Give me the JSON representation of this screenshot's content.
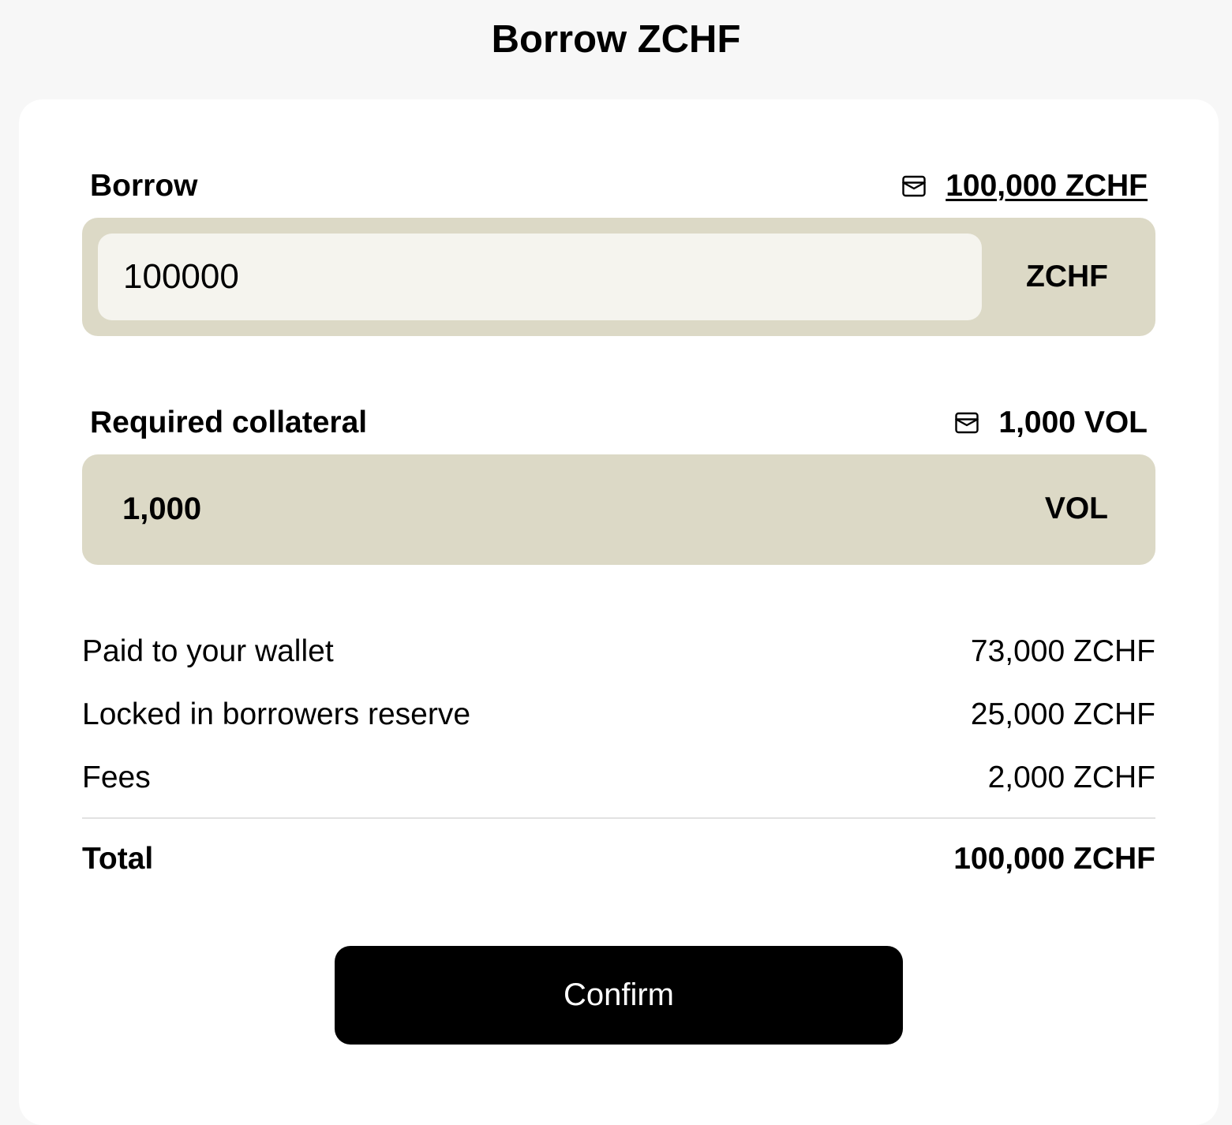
{
  "header": {
    "title": "Borrow ZCHF"
  },
  "borrow": {
    "label": "Borrow",
    "wallet_icon": "wallet-icon",
    "balance": "100,000 ZCHF",
    "input_value": "100000",
    "unit": "ZCHF"
  },
  "collateral": {
    "label": "Required collateral",
    "wallet_icon": "wallet-icon",
    "balance": "1,000 VOL",
    "value": "1,000",
    "unit": "VOL"
  },
  "summary": {
    "rows": [
      {
        "label": "Paid to your wallet",
        "value": "73,000 ZCHF"
      },
      {
        "label": "Locked in borrowers reserve",
        "value": "25,000 ZCHF"
      },
      {
        "label": "Fees",
        "value": "2,000 ZCHF"
      }
    ],
    "total": {
      "label": "Total",
      "value": "100,000 ZCHF"
    }
  },
  "actions": {
    "confirm_label": "Confirm"
  },
  "colors": {
    "page_background": "#f7f7f7",
    "card_background": "#ffffff",
    "input_container": "#dcd9c6",
    "input_field": "#f5f4ee",
    "button_background": "#000000",
    "button_text": "#ffffff"
  }
}
